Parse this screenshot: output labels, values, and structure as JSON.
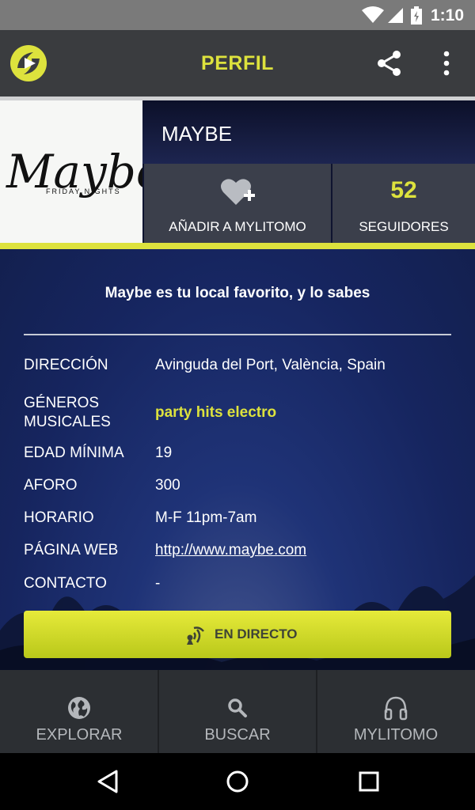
{
  "status_bar": {
    "time": "1:10",
    "icons": [
      "wifi-icon",
      "signal-icon",
      "battery-icon"
    ]
  },
  "app_bar": {
    "title": "PERFIL",
    "logo": "app-logo",
    "actions": [
      "share-icon",
      "more-vert-icon"
    ]
  },
  "venue": {
    "name": "MAYBE",
    "logo_text": "Maybe",
    "logo_subtext": "FRIDAY NIGHTS",
    "add_label": "AÑADIR A MYLITOMO",
    "followers_count": "52",
    "followers_label": "SEGUIDORES"
  },
  "details": {
    "tagline": "Maybe es tu local favorito, y lo sabes",
    "rows": [
      {
        "label": "DIRECCIÓN",
        "value": "Avinguda del Port, València, Spain"
      },
      {
        "label": "GÉNEROS MUSICALES",
        "value": "party hits electro"
      },
      {
        "label": "EDAD MÍNIMA",
        "value": "19"
      },
      {
        "label": "AFORO",
        "value": "300"
      },
      {
        "label": "HORARIO",
        "value": "M-F 11pm-7am"
      },
      {
        "label": "PÁGINA WEB",
        "value": "http://www.maybe.com"
      },
      {
        "label": "CONTACTO",
        "value": "-"
      }
    ],
    "live_button": "EN DIRECTO"
  },
  "bottom_nav": [
    {
      "label": "EXPLORAR",
      "icon": "globe-icon"
    },
    {
      "label": "BUSCAR",
      "icon": "search-icon"
    },
    {
      "label": "MYLITOMO",
      "icon": "headphones-icon"
    }
  ],
  "colors": {
    "accent": "#dde23d",
    "app_bar": "#3a3c3f",
    "background": "#1f3377"
  }
}
